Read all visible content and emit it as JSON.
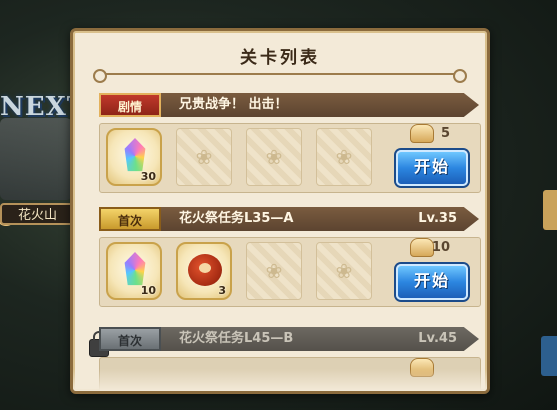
{
  "background": {
    "next_label": "NEXT",
    "place_label": "花火山"
  },
  "panel": {
    "title": "关卡列表"
  },
  "stages": [
    {
      "badge": "剧情",
      "badge_type": "story",
      "name": "兄贵战争！ 出击！",
      "level": "",
      "rewards": [
        {
          "icon": "rainbow-crystal-icon",
          "qty": "30"
        }
      ],
      "cost": "5",
      "start_label": "开始"
    },
    {
      "badge": "首次",
      "badge_type": "first",
      "name": "花火祭任务L35—A",
      "level": "Lv.35",
      "rewards": [
        {
          "icon": "rainbow-crystal-icon",
          "qty": "10"
        },
        {
          "icon": "roast-meat-icon",
          "qty": "3"
        }
      ],
      "cost": "10",
      "start_label": "开始"
    },
    {
      "badge": "首次",
      "badge_type": "locked",
      "name": "花火祭任务L45—B",
      "level": "Lv.45"
    }
  ]
}
